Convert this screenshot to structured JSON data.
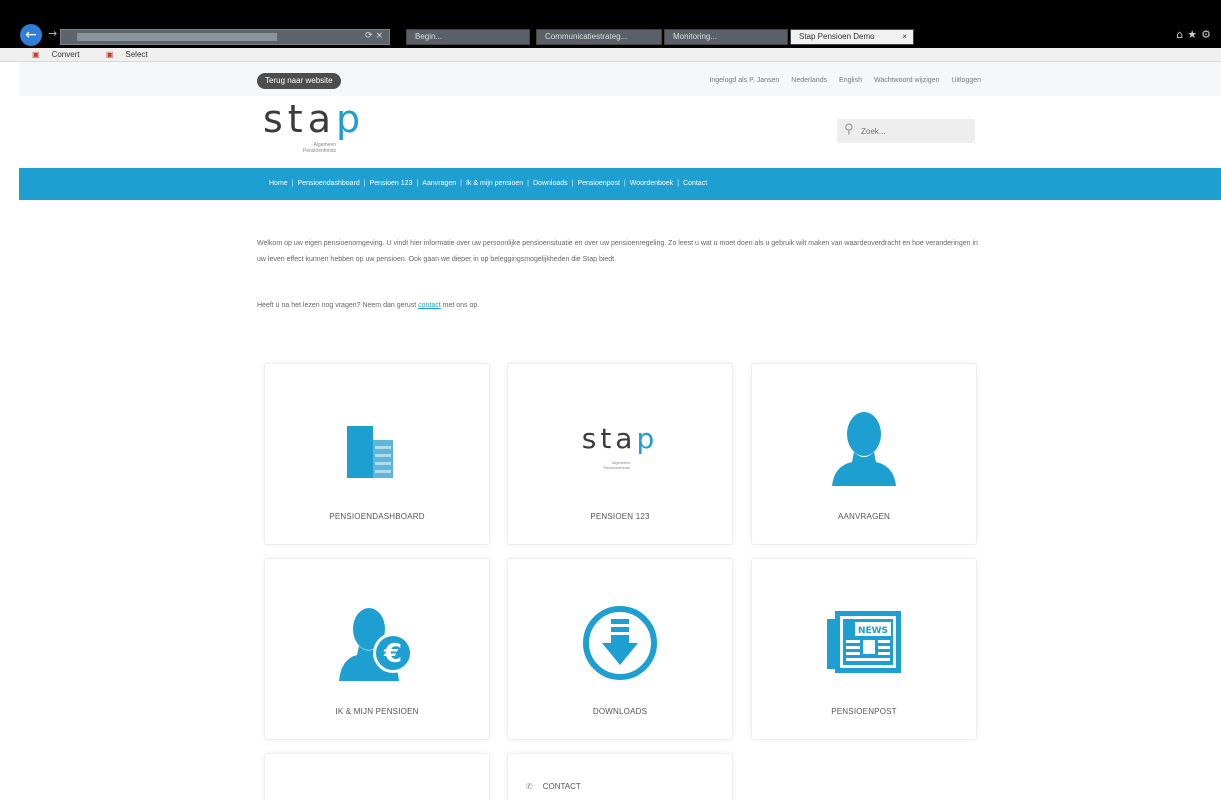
{
  "browser": {
    "tabs": [
      {
        "label": "Begin..."
      },
      {
        "label": "Communicatiestrateg..."
      },
      {
        "label": "Monitoring..."
      },
      {
        "label": "Stap Pensioen Demo",
        "active": true
      }
    ],
    "favorites": [
      "Convert",
      "Select"
    ]
  },
  "header": {
    "back_button": "Terug naar website",
    "top_links": [
      "Ingelogd als P. Jansen",
      "Nederlands",
      "English",
      "Wachtwoord wijzigen",
      "Uitloggen"
    ],
    "logo_text_main": "sta",
    "logo_text_accent": "p",
    "logo_subtitle": "Algemeen Pensioenfonds",
    "search_placeholder": "Zoek..."
  },
  "nav": {
    "items": [
      "Home",
      "Pensioendashboard",
      "Pensioen 123",
      "Aanvragen",
      "Ik & mijn pensioen",
      "Downloads",
      "Pensioenpost",
      "Woordenboek",
      "Contact"
    ],
    "separator": "|"
  },
  "intro": {
    "paragraph": "Welkom op uw eigen pensioenomgeving. U vindt hier informatie over uw persoonlijke pensioensituatie en over uw pensioenregeling. Zo leest u wat u moet doen als u gebruik wilt maken van waardeoverdracht en hoe veranderingen in uw leven effect kunnen hebben op uw pensioen. Ook gaan we dieper in op beleggingsmogelijkheden die Stap biedt.",
    "question_before": "Heeft u na het lezen nog vragen? Neem dan gerust",
    "question_link": "contact",
    "question_after": "met ons op."
  },
  "tiles": [
    {
      "label": "PENSIOENDASHBOARD",
      "icon": "dashboard-icon"
    },
    {
      "label": "PENSIOEN 123",
      "icon": "stap-logo"
    },
    {
      "label": "AANVRAGEN",
      "icon": "person-icon"
    },
    {
      "label": "IK & MIJN PENSIOEN",
      "icon": "person-euro-icon"
    },
    {
      "label": "DOWNLOADS",
      "icon": "download-icon"
    },
    {
      "label": "PENSIOENPOST",
      "icon": "newspaper-icon"
    },
    {
      "label": "",
      "icon": ""
    },
    {
      "label": "CONTACT",
      "icon": "contact-icon"
    }
  ],
  "tile_logo": {
    "main": "sta",
    "accent": "p",
    "sub": "Algemeen Pensioenfonds"
  },
  "newspaper_text": "NEWS",
  "contact_glyph": "✆",
  "colors": {
    "brand_blue": "#1e9fd1",
    "nav_bg": "#1e9fd1",
    "logo_dark": "#3b3b3b"
  }
}
